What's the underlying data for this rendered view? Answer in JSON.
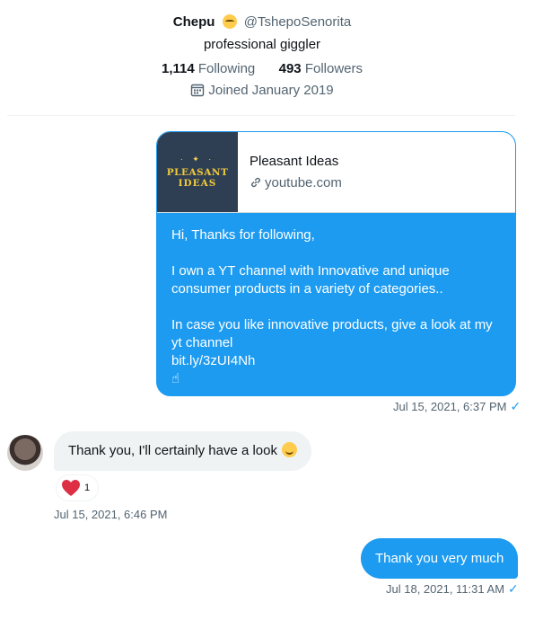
{
  "profile": {
    "name": "Chepu",
    "handle": "@TshepoSenorita",
    "bio": "professional giggler",
    "following_count": "1,114",
    "following_label": "Following",
    "followers_count": "493",
    "followers_label": "Followers",
    "joined": "Joined January 2019",
    "name_emoji": "relieved-face-emoji",
    "joined_icon": "calendar-icon"
  },
  "messages": [
    {
      "direction": "outgoing",
      "card": {
        "title": "Pleasant Ideas",
        "domain": "youtube.com",
        "thumb_line1": "PLEASANT",
        "thumb_line2": "IDEAS",
        "domain_icon": "link-icon"
      },
      "lines": [
        "Hi, Thanks for following,",
        "I own a YT channel with Innovative and unique",
        "consumer products in a variety of categories..",
        "In case you like innovative products, give a look at my",
        "yt channel",
        "bit.ly/3zUI4Nh",
        "☝"
      ],
      "timestamp": "Jul 15, 2021, 6:37 PM",
      "status": "✓"
    },
    {
      "direction": "incoming",
      "text": "Thank you, I'll certainly have a look",
      "emoji": "smiling-face-emoji",
      "reaction": {
        "icon": "heart-icon",
        "count": "1"
      },
      "timestamp": "Jul 15, 2021, 6:46 PM"
    },
    {
      "direction": "outgoing",
      "text": "Thank you very much",
      "timestamp": "Jul 18, 2021, 11:31 AM",
      "status": "✓"
    }
  ],
  "colors": {
    "accent": "#1d9bf0",
    "incoming_bubble": "#eff3f4",
    "muted_text": "#536471",
    "heart": "#e0245e"
  }
}
